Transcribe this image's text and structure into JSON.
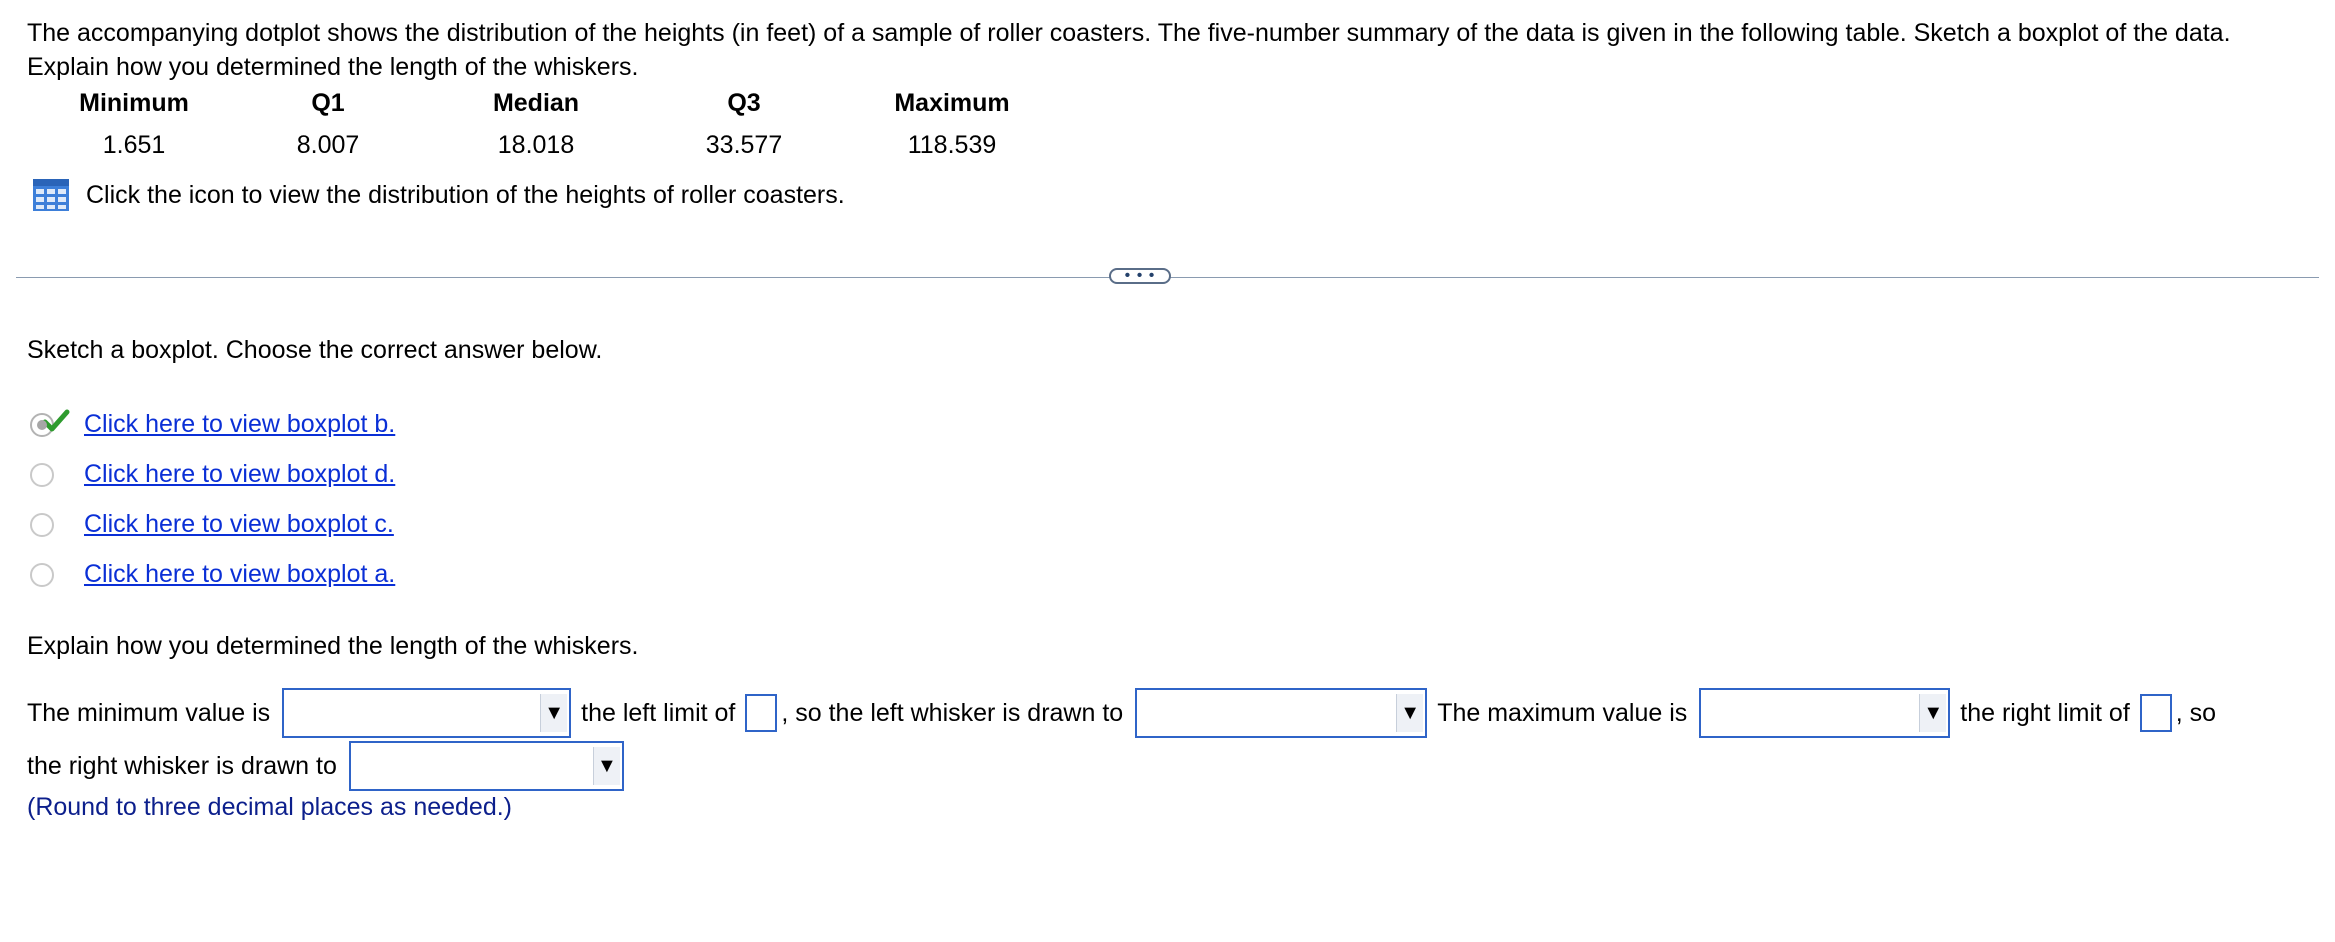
{
  "question": {
    "intro": "The accompanying dotplot shows the distribution of the heights (in feet) of a sample of roller coasters. The five-number summary of the data is given in the following table. Sketch a boxplot of the data. Explain how you determined the length of the whiskers."
  },
  "summary_table": {
    "headers": [
      "Minimum",
      "Q1",
      "Median",
      "Q3",
      "Maximum"
    ],
    "values": [
      "1.651",
      "8.007",
      "18.018",
      "33.577",
      "118.539"
    ]
  },
  "data_link": {
    "icon": "table-grid-icon",
    "text": "Click the icon to view the distribution of the heights of roller coasters."
  },
  "divider": {
    "button_label": "• • •"
  },
  "part1": {
    "prompt": "Sketch a boxplot. Choose the correct answer below.",
    "options": [
      {
        "label": "Click here to view boxplot b.",
        "selected": true,
        "correct_mark": "check-icon"
      },
      {
        "label": "Click here to view boxplot d.",
        "selected": false
      },
      {
        "label": "Click here to view boxplot c.",
        "selected": false
      },
      {
        "label": "Click here to view boxplot a.",
        "selected": false
      }
    ]
  },
  "part2": {
    "prompt": "Explain how you determined the length of the whiskers.",
    "sentence": {
      "min_text": "The minimum value is",
      "left_limit_text": "the left limit of",
      "left_whisker_text": ", so the left whisker is drawn to",
      "max_text": "The maximum value is",
      "right_limit_text": "the right limit of",
      "so_text": ", so",
      "right_whisker_text": "the right whisker is drawn to"
    },
    "dropdown_arrow": "▼",
    "note": "(Round to three decimal places as needed.)"
  },
  "colors": {
    "link": "#0a2fd6",
    "input_border": "#2f64c8",
    "note": "#0c1f8c",
    "check": "#2e9b2e"
  }
}
